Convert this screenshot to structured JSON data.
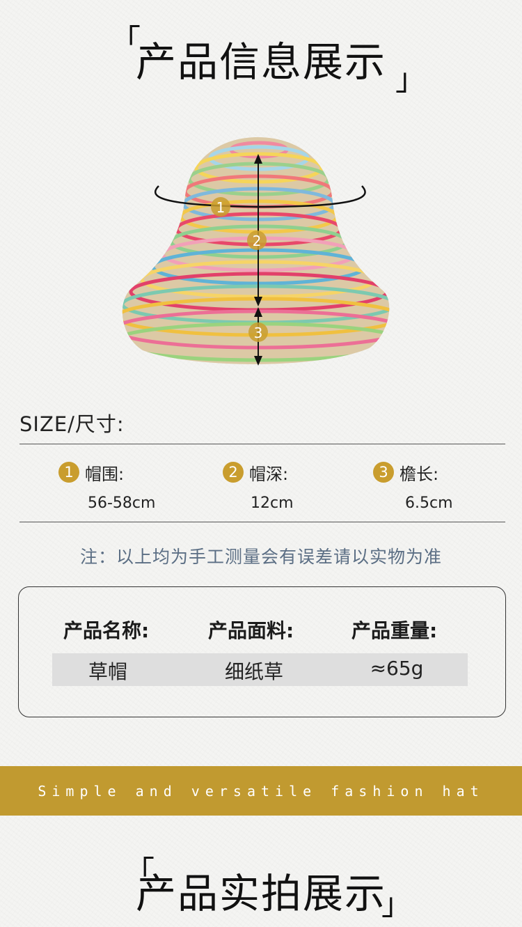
{
  "section1": {
    "title": "产品信息展示",
    "open_bracket": "「",
    "close_bracket": "」"
  },
  "hat": {
    "markers": [
      "1",
      "2",
      "3"
    ],
    "colors": {
      "base": "#d9c7a4",
      "accent": "#c99d2e",
      "line": "#111111"
    }
  },
  "size": {
    "label": "SIZE/尺寸:",
    "items": [
      {
        "num": "1",
        "name": "帽围:",
        "value": "56-58cm"
      },
      {
        "num": "2",
        "name": "帽深:",
        "value": "12cm"
      },
      {
        "num": "3",
        "name": "檐长:",
        "value": "6.5cm"
      }
    ]
  },
  "note": "注：以上均为手工测量会有误差请以实物为准",
  "info": {
    "headers": [
      "产品名称:",
      "产品面料:",
      "产品重量:"
    ],
    "values": [
      "草帽",
      "细纸草",
      "≈65g"
    ]
  },
  "banner": {
    "text": "Simple and versatile fashion hat",
    "color": "#c19a30"
  },
  "section2": {
    "title": "产品实拍展示",
    "open_bracket": "「",
    "close_bracket": "」"
  }
}
